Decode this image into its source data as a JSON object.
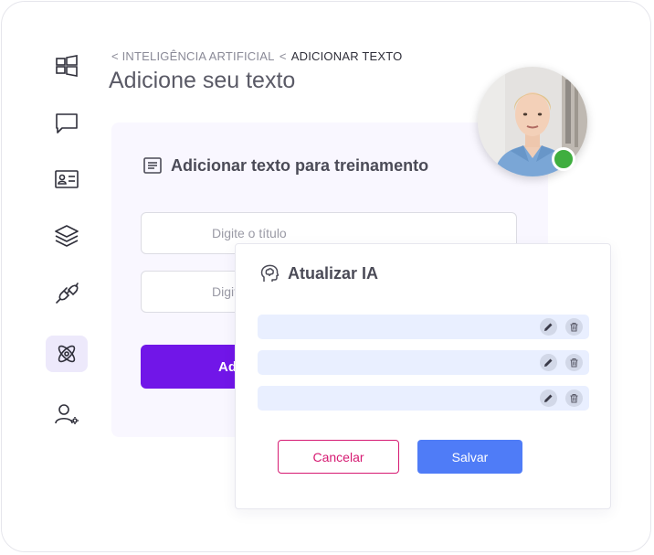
{
  "breadcrumb": {
    "parent": "< INTELIGÊNCIA ARTIFICIAL",
    "separator": "<",
    "current": "ADICIONAR TEXTO"
  },
  "page": {
    "title": "Adicione seu texto"
  },
  "sidebar": {
    "items": [
      {
        "icon": "dashboard-icon",
        "active": false
      },
      {
        "icon": "chat-icon",
        "active": false
      },
      {
        "icon": "contact-card-icon",
        "active": false
      },
      {
        "icon": "layers-icon",
        "active": false
      },
      {
        "icon": "plug-icon",
        "active": false
      },
      {
        "icon": "atom-icon",
        "active": true
      },
      {
        "icon": "user-settings-icon",
        "active": false
      }
    ]
  },
  "training_card": {
    "title": "Adicionar texto para treinamento",
    "title_placeholder": "Digite o título",
    "text_placeholder": "Digite o texto",
    "submit_label": "Adicionar"
  },
  "avatar": {
    "status": "online",
    "status_color": "#3fae3f"
  },
  "update_modal": {
    "title": "Atualizar IA",
    "rows": [
      {
        "text": ""
      },
      {
        "text": ""
      },
      {
        "text": ""
      }
    ],
    "cancel_label": "Cancelar",
    "save_label": "Salvar"
  },
  "colors": {
    "primary": "#7116e8",
    "save": "#4f7cf7",
    "cancel": "#d61a72",
    "card_bg": "#f9f7ff",
    "row_bg": "#e9efff"
  }
}
